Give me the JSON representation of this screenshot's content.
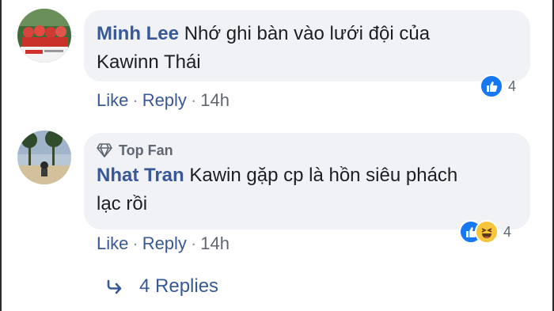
{
  "comments": [
    {
      "author": "Minh Lee",
      "text_line1": "Nhớ ghi bàn vào lưới đội của",
      "text_line2": "Kawinn Thái",
      "like_label": "Like",
      "reply_label": "Reply",
      "time": "14h",
      "reaction_count": "4",
      "reactions": [
        "like-icon"
      ]
    },
    {
      "badge": "Top Fan",
      "author": "Nhat Tran",
      "text_line1": "Kawin gặp cp là hồn siêu phách",
      "text_line2": "lạc rồi",
      "like_label": "Like",
      "reply_label": "Reply",
      "time": "14h",
      "reaction_count": "4",
      "reactions": [
        "like-icon",
        "haha-icon"
      ]
    }
  ],
  "replies": {
    "label": "4 Replies",
    "icon": "reply-arrow-icon"
  },
  "colors": {
    "bubble": "#f0f2f5",
    "author": "#385898",
    "like_blue": "#1877f2",
    "haha_yellow": "#f7c53a"
  }
}
